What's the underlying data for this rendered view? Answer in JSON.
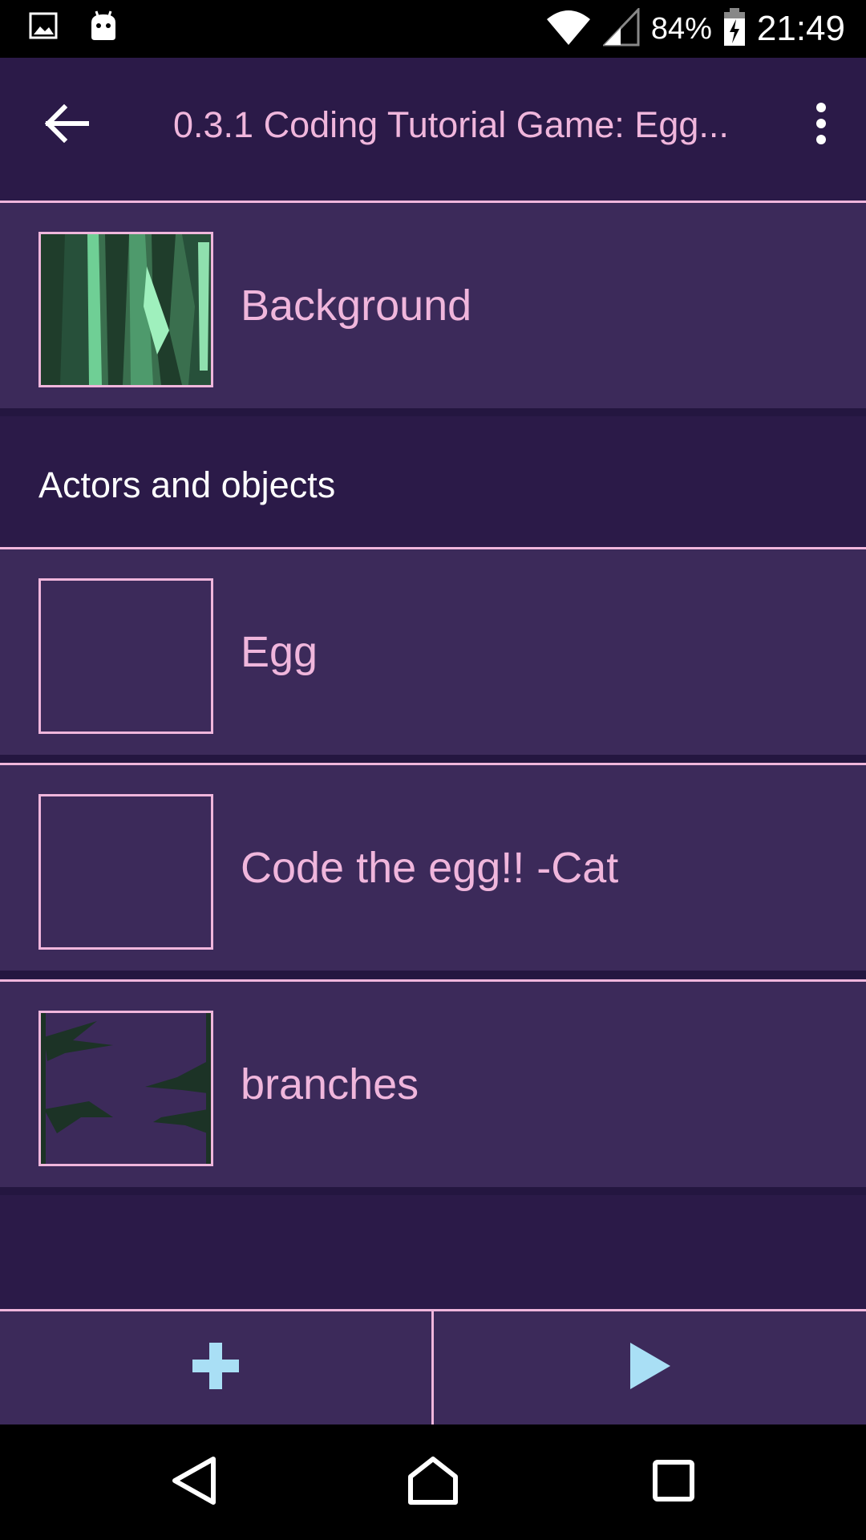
{
  "status_bar": {
    "battery": "84%",
    "time": "21:49",
    "icons": [
      "image-icon",
      "android-icon",
      "wifi-icon",
      "signal-icon",
      "battery-charging-icon"
    ]
  },
  "toolbar": {
    "title": "0.3.1 Coding Tutorial Game: Egg..."
  },
  "background_item": {
    "label": "Background"
  },
  "section": {
    "label": "Actors and objects"
  },
  "items": [
    {
      "label": "Egg"
    },
    {
      "label": "Code the egg!! -Cat"
    },
    {
      "label": "branches"
    }
  ],
  "actions": {
    "add_icon": "plus-icon",
    "play_icon": "play-icon"
  },
  "colors": {
    "accent": "#f0b6dc",
    "background": "#2b1a48",
    "row": "#3c2a5a",
    "action_icon": "#a9dff5"
  }
}
